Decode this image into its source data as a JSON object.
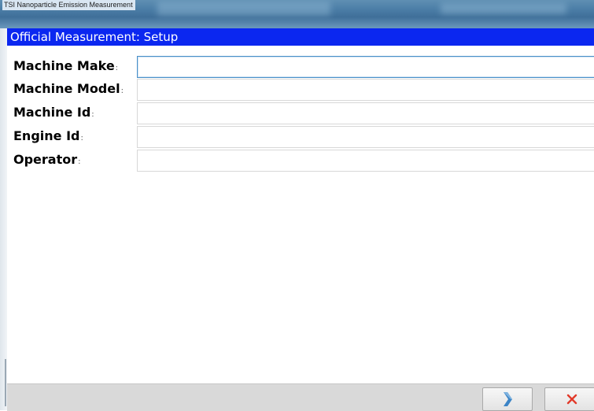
{
  "window": {
    "title": "TSI Nanoparticle Emission Measurement"
  },
  "header": {
    "title": "Official Measurement: Setup"
  },
  "form": {
    "fields": [
      {
        "label": "Machine Make",
        "value": "",
        "focused": true
      },
      {
        "label": "Machine Model",
        "value": ""
      },
      {
        "label": "Machine Id",
        "value": ""
      },
      {
        "label": "Engine Id",
        "value": ""
      },
      {
        "label": "Operator",
        "value": ""
      }
    ]
  },
  "footer": {
    "next_icon": "chevron-right-icon",
    "cancel_icon": "close-icon"
  },
  "colors": {
    "header_bg": "#0b27f0",
    "next_icon": "#3c84c6",
    "cancel_icon": "#e23a2a"
  }
}
